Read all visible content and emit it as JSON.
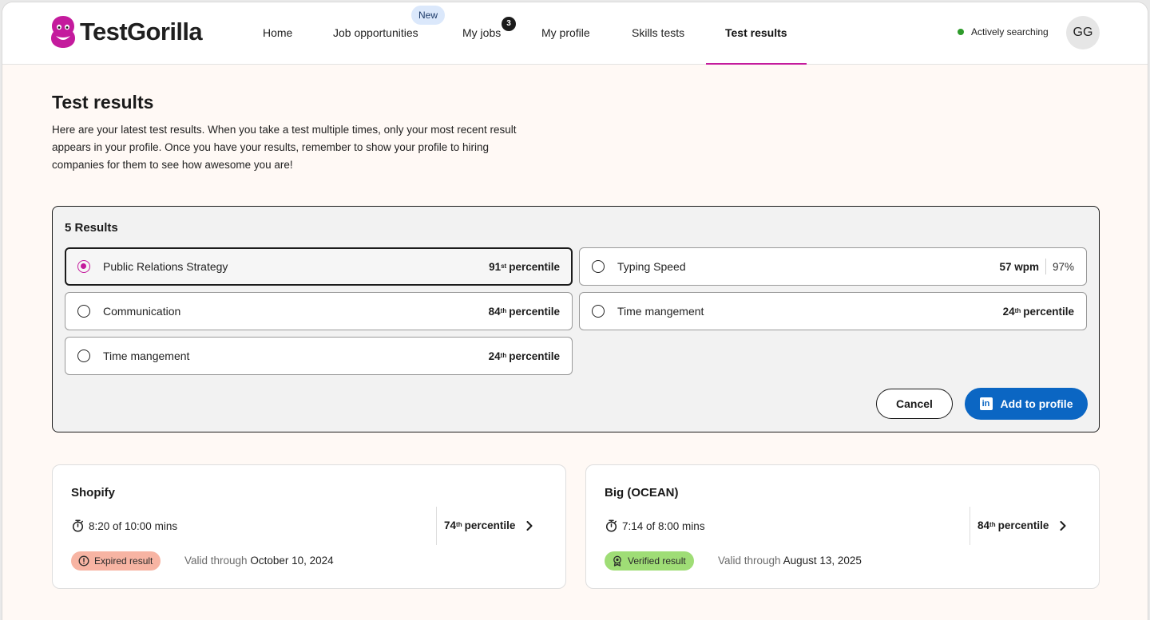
{
  "header": {
    "brand": "TestGorilla",
    "nav": [
      {
        "label": "Home"
      },
      {
        "label": "Job opportunities",
        "pill": "New"
      },
      {
        "label": "My jobs",
        "badge": "3"
      },
      {
        "label": "My profile"
      },
      {
        "label": "Skills tests"
      },
      {
        "label": "Test results",
        "active": true
      }
    ],
    "status": "Actively searching",
    "avatar_initials": "GG",
    "accent_color": "#c41b9d"
  },
  "page": {
    "title": "Test results",
    "intro": "Here are your latest test results. When you take a test multiple times, only your most recent result appears in your profile. Once you have your results, remember to show your profile to hiring companies for them to see how awesome you are!"
  },
  "results_panel": {
    "heading": "5 Results",
    "options": [
      {
        "label": "Public Relations Strategy",
        "rank": "91",
        "suffix": "st",
        "unit": "percentile",
        "selected": true
      },
      {
        "label": "Typing Speed",
        "wpm": "57 wpm",
        "accuracy": "97%",
        "selected": false
      },
      {
        "label": "Communication",
        "rank": "84",
        "suffix": "th",
        "unit": "percentile",
        "selected": false
      },
      {
        "label": "Time mangement",
        "rank": "24",
        "suffix": "th",
        "unit": "percentile",
        "selected": false
      },
      {
        "label": "Time mangement",
        "rank": "24",
        "suffix": "th",
        "unit": "percentile",
        "selected": false
      }
    ],
    "cancel_label": "Cancel",
    "add_label": "Add to profile",
    "add_color": "#0b66c3"
  },
  "cards": [
    {
      "title": "Shopify",
      "time": "8:20 of 10:00 mins",
      "rank": "74",
      "suffix": "th",
      "unit": "percentile",
      "badge": "Expired result",
      "badge_color": "#f7b4a3",
      "valid_prefix": "Valid through",
      "valid_date": "October 10, 2024"
    },
    {
      "title": "Big (OCEAN)",
      "time": "7:14 of 8:00 mins",
      "rank": "84",
      "suffix": "th",
      "unit": "percentile",
      "badge": "Verified result",
      "badge_color": "#9fdd76",
      "valid_prefix": "Valid through",
      "valid_date": "August 13, 2025"
    }
  ]
}
